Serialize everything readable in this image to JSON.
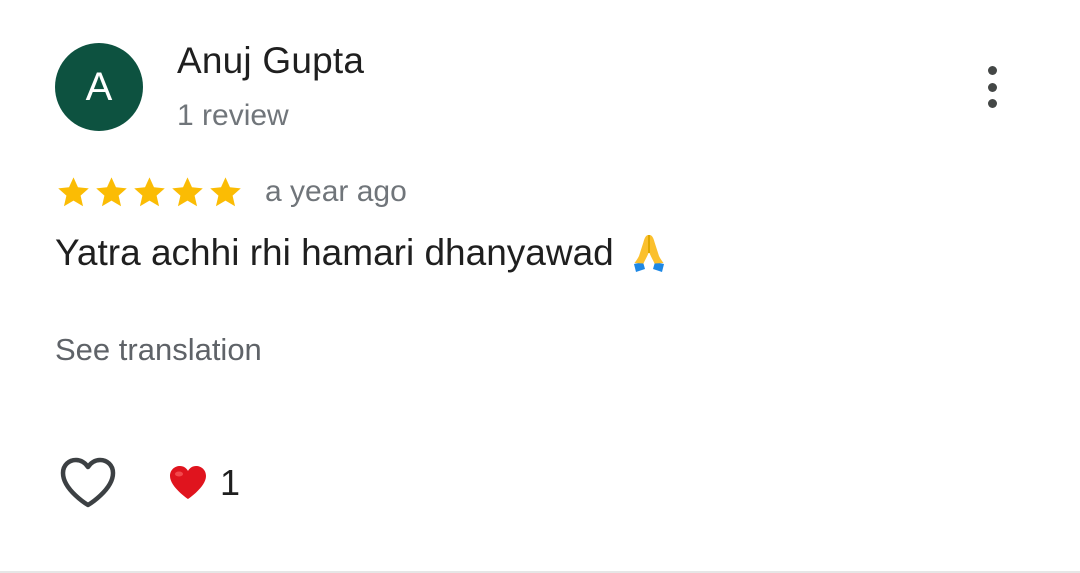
{
  "review": {
    "avatar_letter": "A",
    "avatar_color": "#0d5240",
    "author_name": "Anuj Gupta",
    "review_count": "1 review",
    "rating": 5,
    "rating_max": 5,
    "time_ago": "a year ago",
    "text": "Yatra achhi rhi hamari dhanyawad",
    "text_emoji": "folded-hands-emoji",
    "see_translation": "See translation",
    "reaction_count": "1",
    "icons": {
      "more": "more-vert-icon",
      "like": "heart-outline-icon",
      "reaction": "red-heart-emoji"
    },
    "colors": {
      "star": "#fbbc04",
      "heart": "#e0141e"
    }
  }
}
